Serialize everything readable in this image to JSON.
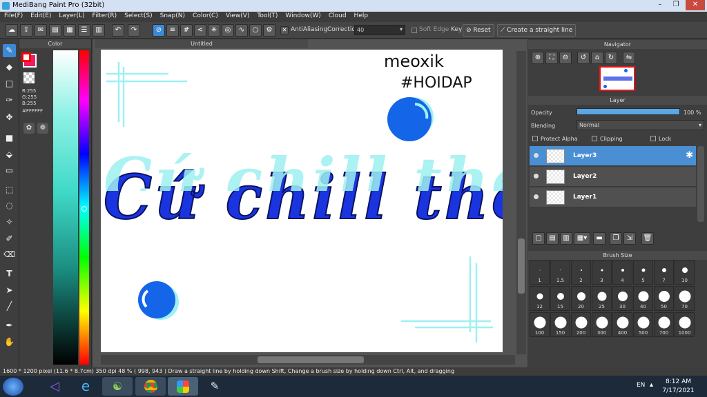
{
  "window": {
    "title": "MediBang Paint Pro (32bit)"
  },
  "menu": [
    "File(F)",
    "Edit(E)",
    "Layer(L)",
    "Filter(R)",
    "Select(S)",
    "Snap(N)",
    "Color(C)",
    "View(V)",
    "Tool(T)",
    "Window(W)",
    "Cloud",
    "Help"
  ],
  "toolbar": {
    "antialias_label": "AntiAliasing",
    "correction_label": "Correction",
    "correction_value": "40",
    "soft_edge_label": "Soft Edge",
    "key_label": "Key",
    "reset_label": "Reset",
    "straight_line_label": "Create a straight line"
  },
  "color_panel": {
    "title": "Color",
    "r": "R:255",
    "g": "G:255",
    "b": "B:255",
    "hex": "#FFFFFF",
    "main_color": "#ff0000"
  },
  "document": {
    "tab": "Untitled"
  },
  "canvas": {
    "handwriting_line1": "meoxik",
    "handwriting_line2": "#HOIDAP",
    "main_text": "Cứ chill thôi",
    "accent_blue": "#1565e8",
    "light_cyan": "#9ef0f2"
  },
  "navigator": {
    "title": "Navigator"
  },
  "layer_panel": {
    "title": "Layer",
    "opacity_label": "Opacity",
    "opacity_value": "100 %",
    "opacity_fraction": 1.0,
    "blending_label": "Blending",
    "blending_value": "Normal",
    "protect_alpha": "Protect Alpha",
    "clipping": "Clipping",
    "lock": "Lock",
    "layers": [
      "Layer3",
      "Layer2",
      "Layer1"
    ],
    "selected": "Layer3"
  },
  "brush_size": {
    "title": "Brush Size",
    "sizes": [
      "1",
      "1.5",
      "2",
      "3",
      "4",
      "5",
      "7",
      "10",
      "12",
      "15",
      "20",
      "25",
      "30",
      "40",
      "50",
      "70",
      "100",
      "150",
      "200",
      "300",
      "400",
      "500",
      "700",
      "1000"
    ]
  },
  "status": {
    "text": "1600 * 1200 pixel   (11.6 * 8.7cm)   350 dpi   48 %   ( 998, 943 )   Draw a straight line by holding down Shift, Change a brush size by holding down Ctrl, Alt, and dragging"
  },
  "taskbar": {
    "lang": "EN",
    "time": "8:12 AM",
    "date": "7/17/2021"
  }
}
